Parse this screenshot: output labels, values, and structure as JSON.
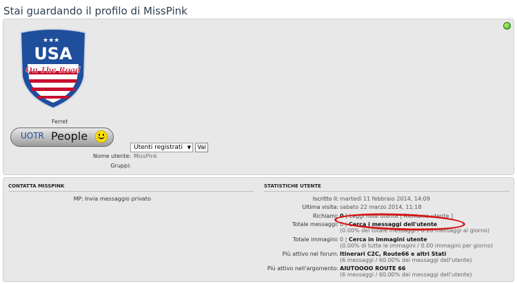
{
  "page": {
    "title": "Stai guardando il profilo di MissPink"
  },
  "logo": {
    "line1": "USA",
    "line2": "On The Road"
  },
  "profile": {
    "rank_title": "Ferret",
    "rank_badge_left": "UOTR",
    "rank_badge_right": "People",
    "username_label": "Nome utente:",
    "username_value": "MissPink",
    "groups_label": "Gruppi:",
    "groups_selected": "Utenti registrati",
    "go_button": "Vai"
  },
  "contact": {
    "heading": "CONTATTA MISSPINK",
    "mp_label": "MP:",
    "mp_value": "Invia messaggio privato"
  },
  "stats": {
    "heading": "STATISTICHE UTENTE",
    "joined_label": "Iscritto il:",
    "joined_value": "martedì 11 febbraio 2014, 14:09",
    "last_visit_label": "Ultima visita:",
    "last_visit_value": "sabato 22 marzo 2014, 11:18",
    "warnings_label": "Richiami:",
    "warnings_value": "0",
    "warnings_links": "[ Leggi note utente | Richiamo utente ]",
    "posts_label": "Totale messaggi:",
    "posts_value": "0",
    "posts_link": "Cerca i messaggi dell'utente",
    "posts_sub": "(0.00% del totale messaggi / 0.26 messaggi al giorno)",
    "images_label": "Totale immagini:",
    "images_value": "0",
    "images_link": "Cerca in immagini utente",
    "images_sub": "(0.00% di tutte le immagini / 0.00 immagini per giorno)",
    "active_forum_label": "Più attivo nel forum:",
    "active_forum_value": "Itinerari C2C, Route66 e altri Stati",
    "active_forum_sub": "(6 messaggi / 60.00% dei messaggi dell'utente)",
    "active_topic_label": "Più attivo nell'argomento:",
    "active_topic_value": "AIUTOOOO ROUTE 66",
    "active_topic_sub": "(6 messaggi / 60.00% dei messaggi dell'utente)"
  },
  "colors": {
    "annotation_oval": "#d61414",
    "online_indicator": "#3da21a"
  }
}
